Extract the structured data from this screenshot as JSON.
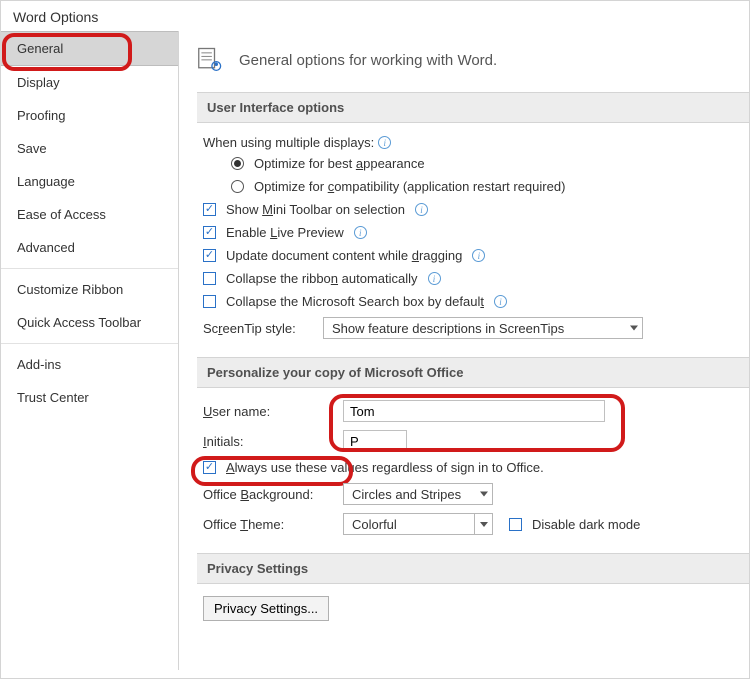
{
  "window_title": "Word Options",
  "sidebar": {
    "items": [
      "General",
      "Display",
      "Proofing",
      "Save",
      "Language",
      "Ease of Access",
      "Advanced",
      "Customize Ribbon",
      "Quick Access Toolbar",
      "Add-ins",
      "Trust Center"
    ],
    "active_index": 0
  },
  "page": {
    "heading": "General options for working with Word."
  },
  "section_ui": {
    "title": "User Interface options",
    "multi_displays_label": "When using multiple displays:",
    "radios": [
      {
        "label_pre": "Optimize for best ",
        "u": "a",
        "label_post": "ppearance",
        "checked": true
      },
      {
        "label_pre": "Optimize for ",
        "u": "c",
        "label_post": "ompatibility (application restart required)",
        "checked": false
      }
    ],
    "checks": [
      {
        "label_pre": "Show ",
        "u": "M",
        "label_post": "ini Toolbar on selection",
        "checked": true,
        "info": true
      },
      {
        "label_pre": "Enable ",
        "u": "L",
        "label_post": "ive Preview",
        "checked": true,
        "info": true
      },
      {
        "label_pre": "Update document content while ",
        "u": "d",
        "label_post": "ragging",
        "checked": true,
        "info": true
      },
      {
        "label_pre": "Collapse the ribbo",
        "u": "n",
        "label_post": " automatically",
        "checked": false,
        "info": true
      },
      {
        "label_pre": "Collapse the Microsoft Search box by defaul",
        "u": "t",
        "label_post": "",
        "checked": false,
        "info": true
      }
    ],
    "screentip_label_pre": "Sc",
    "screentip_label_u": "r",
    "screentip_label_post": "eenTip style:",
    "screentip_value": "Show feature descriptions in ScreenTips"
  },
  "section_personalize": {
    "title": "Personalize your copy of Microsoft Office",
    "username_label_u": "U",
    "username_label_post": "ser name:",
    "username_value": "Tom",
    "initials_label_u": "I",
    "initials_label_post": "nitials:",
    "initials_value": "P",
    "always_check_u": "A",
    "always_check_post": "lways use these values regardless of sign in to Office.",
    "always_checked": true,
    "background_label_pre": "Office ",
    "background_label_u": "B",
    "background_label_post": "ackground:",
    "background_value": "Circles and Stripes",
    "theme_label_pre": "Office ",
    "theme_label_u": "T",
    "theme_label_post": "heme:",
    "theme_value": "Colorful",
    "disable_dark_label": "Disable dark mode",
    "disable_dark_checked": false
  },
  "section_privacy": {
    "title": "Privacy Settings",
    "button": "Privacy Settings..."
  }
}
